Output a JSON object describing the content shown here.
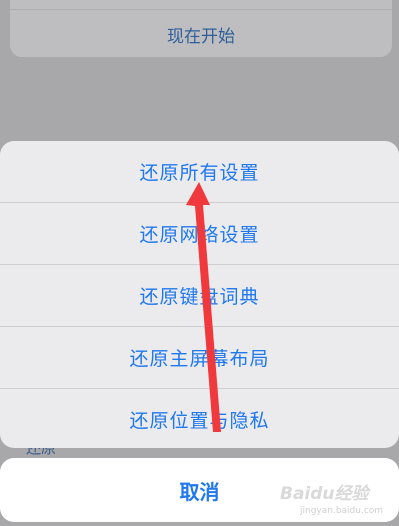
{
  "background": {
    "start_now_label": "现在开始",
    "partial_text": "还原"
  },
  "action_sheet": {
    "items": [
      {
        "label": "还原所有设置"
      },
      {
        "label": "还原网络设置"
      },
      {
        "label": "还原键盘词典"
      },
      {
        "label": "还原主屏幕布局"
      },
      {
        "label": "还原位置与隐私"
      }
    ],
    "cancel_label": "取消"
  },
  "annotation": {
    "arrow_color": "#f0393d"
  },
  "watermark": {
    "brand": "Baidu经验",
    "url": "jingyan.baidu.com"
  }
}
